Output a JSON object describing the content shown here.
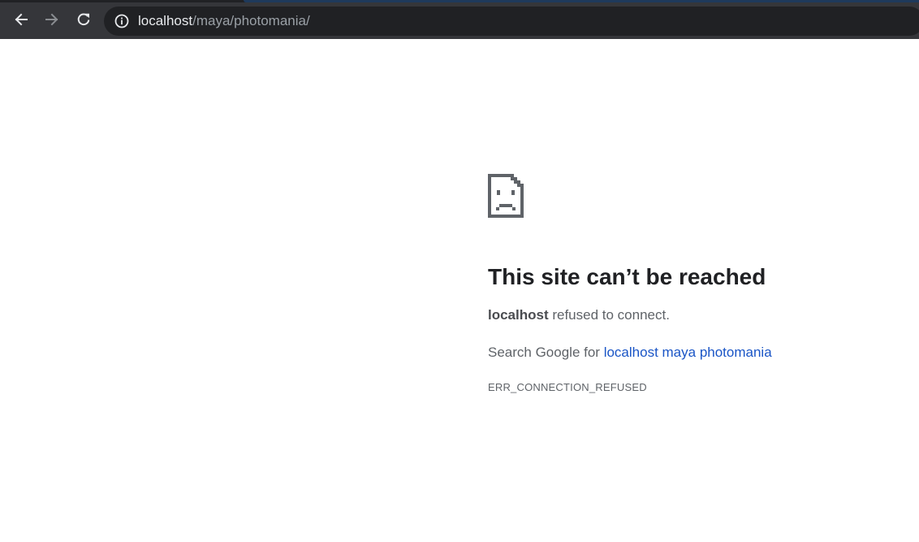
{
  "browser": {
    "url_host": "localhost",
    "url_path": "/maya/photomania/",
    "icons": {
      "back": "back-arrow-icon",
      "forward": "forward-arrow-icon",
      "reload": "reload-icon",
      "site_info": "info-icon"
    },
    "colors": {
      "toolbar": "#35363a",
      "omnibox": "#202124",
      "tab_accent": "#1e3a5c"
    }
  },
  "error_page": {
    "icon": "sad-document-icon",
    "headline": "This site can’t be reached",
    "host": "localhost",
    "summary_rest": " refused to connect.",
    "search_prefix": "Search Google for ",
    "search_link": "localhost maya photomania",
    "error_code": "ERR_CONNECTION_REFUSED",
    "colors": {
      "headline": "#202124",
      "body_text": "#5f6368",
      "link": "#1a55c6"
    }
  }
}
